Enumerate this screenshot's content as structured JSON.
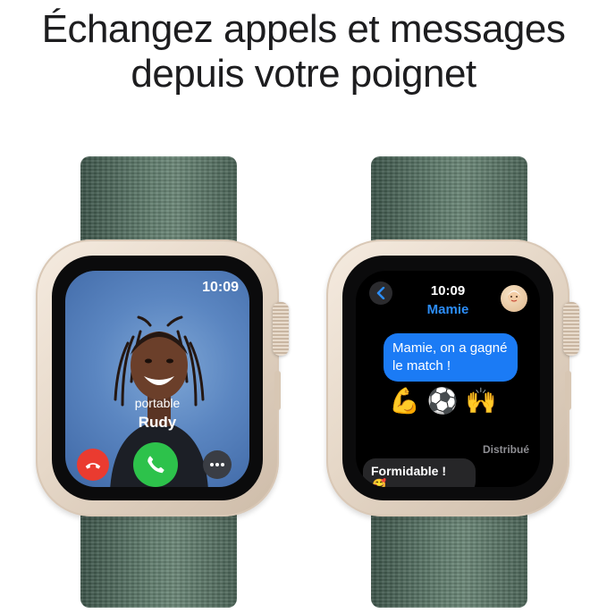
{
  "headline": {
    "line1": "Échangez appels et messages",
    "line2": "depuis votre poignet"
  },
  "call_screen": {
    "time": "10:09",
    "caller_label": "portable",
    "caller_name": "Rudy",
    "actions": [
      {
        "name": "decline",
        "icon": "phone-hangup-icon",
        "color": "#ea3b30"
      },
      {
        "name": "accept",
        "icon": "phone-icon",
        "color": "#2dc24b"
      },
      {
        "name": "more",
        "icon": "ellipsis-icon",
        "color": "#3a3d44"
      }
    ]
  },
  "message_screen": {
    "time": "10:09",
    "contact_name": "Mamie",
    "sent_message": "Mamie, on a gagné le match !",
    "emojis": [
      "💪",
      "⚽",
      "🙌"
    ],
    "status": "Distribué",
    "received_message": "Formidable !",
    "received_emoji": "🥰"
  },
  "colors": {
    "band": "#5e7a6b",
    "case": "#e6d8c8",
    "accent_blue": "#1b7bf5"
  }
}
